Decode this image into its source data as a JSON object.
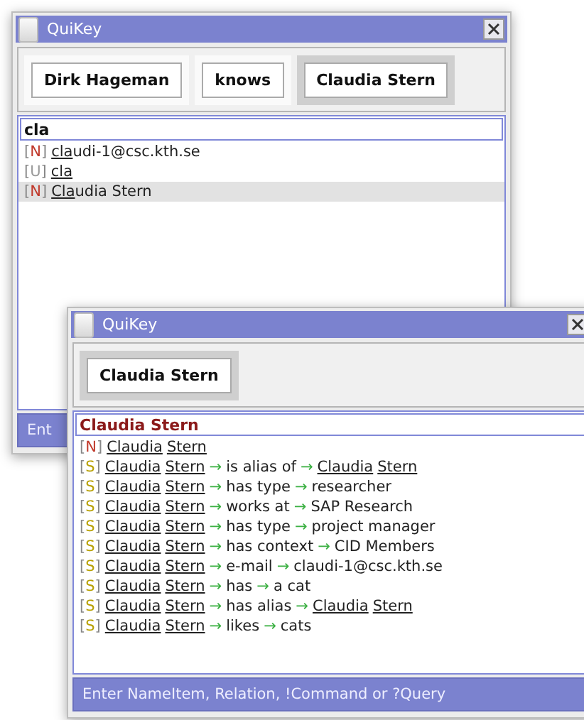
{
  "windows": [
    {
      "title": "QuiKey",
      "chips": [
        {
          "label": "Dirk Hageman",
          "selected": false
        },
        {
          "label": "knows",
          "selected": false
        },
        {
          "label": "Claudia Stern",
          "selected": true
        }
      ],
      "input": "cla",
      "rows": [
        {
          "tag": "[N]",
          "color": "#c0392b",
          "selected": false,
          "segments": [
            {
              "kind": "match",
              "text": "cla"
            },
            {
              "kind": "text",
              "text": "udi-1@csc.kth.se"
            }
          ]
        },
        {
          "tag": "[U]",
          "color": "#9a9a9a",
          "selected": false,
          "segments": [
            {
              "kind": "match",
              "text": "cla"
            }
          ]
        },
        {
          "tag": "[N]",
          "color": "#c0392b",
          "selected": true,
          "segments": [
            {
              "kind": "match",
              "text": "Cla"
            },
            {
              "kind": "text",
              "text": "udia Stern"
            }
          ]
        }
      ],
      "status": "Ent"
    },
    {
      "title": "QuiKey",
      "chips": [
        {
          "label": "Claudia Stern",
          "selected": true
        }
      ],
      "input": "Claudia Stern",
      "rows": [
        {
          "tag": "[N]",
          "color": "#c0392b",
          "selected": false,
          "segments": [
            {
              "kind": "link",
              "text": "Claudia"
            },
            {
              "kind": "link",
              "text": "Stern"
            }
          ]
        },
        {
          "tag": "[S]",
          "color": "#b8a000",
          "selected": false,
          "segments": [
            {
              "kind": "link",
              "text": "Claudia"
            },
            {
              "kind": "link",
              "text": "Stern"
            },
            {
              "kind": "arrow",
              "text": "→"
            },
            {
              "kind": "text",
              "text": "is alias of"
            },
            {
              "kind": "arrow",
              "text": "→"
            },
            {
              "kind": "link",
              "text": "Claudia"
            },
            {
              "kind": "link",
              "text": "Stern"
            }
          ]
        },
        {
          "tag": "[S]",
          "color": "#b8a000",
          "selected": false,
          "segments": [
            {
              "kind": "link",
              "text": "Claudia"
            },
            {
              "kind": "link",
              "text": "Stern"
            },
            {
              "kind": "arrow",
              "text": "→"
            },
            {
              "kind": "text",
              "text": "has type"
            },
            {
              "kind": "arrow",
              "text": "→"
            },
            {
              "kind": "text",
              "text": "researcher"
            }
          ]
        },
        {
          "tag": "[S]",
          "color": "#b8a000",
          "selected": false,
          "segments": [
            {
              "kind": "link",
              "text": "Claudia"
            },
            {
              "kind": "link",
              "text": "Stern"
            },
            {
              "kind": "arrow",
              "text": "→"
            },
            {
              "kind": "text",
              "text": "works at"
            },
            {
              "kind": "arrow",
              "text": "→"
            },
            {
              "kind": "text",
              "text": "SAP Research"
            }
          ]
        },
        {
          "tag": "[S]",
          "color": "#b8a000",
          "selected": false,
          "segments": [
            {
              "kind": "link",
              "text": "Claudia"
            },
            {
              "kind": "link",
              "text": "Stern"
            },
            {
              "kind": "arrow",
              "text": "→"
            },
            {
              "kind": "text",
              "text": "has type"
            },
            {
              "kind": "arrow",
              "text": "→"
            },
            {
              "kind": "text",
              "text": "project manager"
            }
          ]
        },
        {
          "tag": "[S]",
          "color": "#b8a000",
          "selected": false,
          "segments": [
            {
              "kind": "link",
              "text": "Claudia"
            },
            {
              "kind": "link",
              "text": "Stern"
            },
            {
              "kind": "arrow",
              "text": "→"
            },
            {
              "kind": "text",
              "text": "has context"
            },
            {
              "kind": "arrow",
              "text": "→"
            },
            {
              "kind": "text",
              "text": "CID Members"
            }
          ]
        },
        {
          "tag": "[S]",
          "color": "#b8a000",
          "selected": false,
          "segments": [
            {
              "kind": "link",
              "text": "Claudia"
            },
            {
              "kind": "link",
              "text": "Stern"
            },
            {
              "kind": "arrow",
              "text": "→"
            },
            {
              "kind": "text",
              "text": "e-mail"
            },
            {
              "kind": "arrow",
              "text": "→"
            },
            {
              "kind": "text",
              "text": "claudi-1@csc.kth.se"
            }
          ]
        },
        {
          "tag": "[S]",
          "color": "#b8a000",
          "selected": false,
          "segments": [
            {
              "kind": "link",
              "text": "Claudia"
            },
            {
              "kind": "link",
              "text": "Stern"
            },
            {
              "kind": "arrow",
              "text": "→"
            },
            {
              "kind": "text",
              "text": "has"
            },
            {
              "kind": "arrow",
              "text": "→"
            },
            {
              "kind": "text",
              "text": "a cat"
            }
          ]
        },
        {
          "tag": "[S]",
          "color": "#b8a000",
          "selected": false,
          "segments": [
            {
              "kind": "link",
              "text": "Claudia"
            },
            {
              "kind": "link",
              "text": "Stern"
            },
            {
              "kind": "arrow",
              "text": "→"
            },
            {
              "kind": "text",
              "text": "has alias"
            },
            {
              "kind": "arrow",
              "text": "→"
            },
            {
              "kind": "link",
              "text": "Claudia"
            },
            {
              "kind": "link",
              "text": "Stern"
            }
          ]
        },
        {
          "tag": "[S]",
          "color": "#b8a000",
          "selected": false,
          "segments": [
            {
              "kind": "link",
              "text": "Claudia"
            },
            {
              "kind": "link",
              "text": "Stern"
            },
            {
              "kind": "arrow",
              "text": "→"
            },
            {
              "kind": "text",
              "text": "likes"
            },
            {
              "kind": "arrow",
              "text": "→"
            },
            {
              "kind": "text",
              "text": "cats"
            }
          ]
        }
      ],
      "status": "Enter NameItem, Relation, !Command or ?Query"
    }
  ]
}
